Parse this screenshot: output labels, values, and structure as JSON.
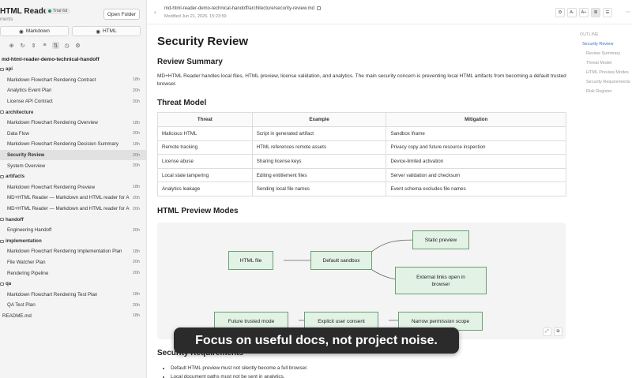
{
  "sidebar": {
    "brand": "HTML Reader",
    "trial_badge": "Trial 6d",
    "subtitle": "ments",
    "open_folder": "Open Folder",
    "mode_markdown": "Markdown",
    "mode_html": "HTML",
    "root_folder": "md-html-reader-demo-technical-handoff",
    "tree": [
      {
        "type": "folder",
        "label": "api"
      },
      {
        "type": "file",
        "label": "Markdown Flowchart Rendering Contract",
        "age": "18h"
      },
      {
        "type": "file",
        "label": "Analytics Event Plan",
        "age": "20h"
      },
      {
        "type": "file",
        "label": "License API Contract",
        "age": "20h"
      },
      {
        "type": "folder",
        "label": "architecture"
      },
      {
        "type": "file",
        "label": "Markdown Flowchart Rendering Overview",
        "age": "18h"
      },
      {
        "type": "file",
        "label": "Data Flow",
        "age": "20h"
      },
      {
        "type": "file",
        "label": "Markdown Flowchart Rendering Decision Summary",
        "age": "18h"
      },
      {
        "type": "file",
        "label": "Security Review",
        "age": "20h",
        "active": true
      },
      {
        "type": "file",
        "label": "System Overview",
        "age": "20h"
      },
      {
        "type": "folder",
        "label": "artifacts"
      },
      {
        "type": "file",
        "label": "Markdown Flowchart Rendering Preview",
        "age": "18h"
      },
      {
        "type": "file",
        "label": "MD+HTML Reader — Markdown and HTML reader for A...",
        "age": "20h"
      },
      {
        "type": "file",
        "label": "MD+HTML Reader — Markdown and HTML reader for A...",
        "age": "20h"
      },
      {
        "type": "folder",
        "label": "handoff"
      },
      {
        "type": "file",
        "label": "Engineering Handoff",
        "age": "20h"
      },
      {
        "type": "folder",
        "label": "implementation"
      },
      {
        "type": "file",
        "label": "Markdown Flowchart Rendering Implementation Plan",
        "age": "18h"
      },
      {
        "type": "file",
        "label": "File Watcher Plan",
        "age": "20h"
      },
      {
        "type": "file",
        "label": "Rendering Pipeline",
        "age": "20h"
      },
      {
        "type": "folder",
        "label": "qa"
      },
      {
        "type": "file",
        "label": "Markdown Flowchart Rendering Test Plan",
        "age": "18h"
      },
      {
        "type": "file",
        "label": "QA Test Plan",
        "age": "20h"
      },
      {
        "type": "rootfile",
        "label": "README.md",
        "age": "18h"
      }
    ]
  },
  "topbar": {
    "path": "md-html-reader-demo-technical-handoff/architecture/security-review.md",
    "modified": "Modified Jun 21, 2026, 15:23:59",
    "font_smaller": "A-",
    "font_larger": "A+"
  },
  "doc": {
    "title": "Security Review",
    "h_summary": "Review Summary",
    "summary_text": "MD+HTML Reader handles local files, HTML preview, license validation, and analytics. The main security concern is preventing local HTML artifacts from becoming a default trusted browser.",
    "h_threat": "Threat Model",
    "table_headers": [
      "Threat",
      "Example",
      "Mitigation"
    ],
    "table_rows": [
      [
        "Malicious HTML",
        "Script in generated artifact",
        "Sandbox iframe"
      ],
      [
        "Remote tracking",
        "HTML references remote assets",
        "Privacy copy and future resource inspection"
      ],
      [
        "License abuse",
        "Sharing license keys",
        "Device-limited activation"
      ],
      [
        "Local state tampering",
        "Editing entitlement files",
        "Server validation and checksum"
      ],
      [
        "Analytics leakage",
        "Sending local file names",
        "Event schema excludes file names"
      ]
    ],
    "h_preview": "HTML Preview Modes",
    "diagram": {
      "html_file": "HTML file",
      "default_sandbox": "Default sandbox",
      "static_preview": "Static preview",
      "external_links": "External links open in browser",
      "future_trusted": "Future trusted mode",
      "explicit_consent": "Explicit user consent",
      "narrow_scope": "Narrow permission scope"
    },
    "h_requirements": "Security Requirements",
    "bullets": [
      "Default HTML preview must not silently become a full browser.",
      "Local document paths must not be sent in analytics."
    ]
  },
  "outline": {
    "heading": "OUTLINE",
    "items": [
      "Security Review",
      "Review Summary",
      "Threat Model",
      "HTML Preview Modes",
      "Security Requirements",
      "Risk Register"
    ]
  },
  "toast": "Focus on useful docs, not project noise.",
  "colors": {
    "accent": "#3b73c4",
    "node_fill": "#e2f2e5",
    "node_border": "#6a9f76"
  }
}
